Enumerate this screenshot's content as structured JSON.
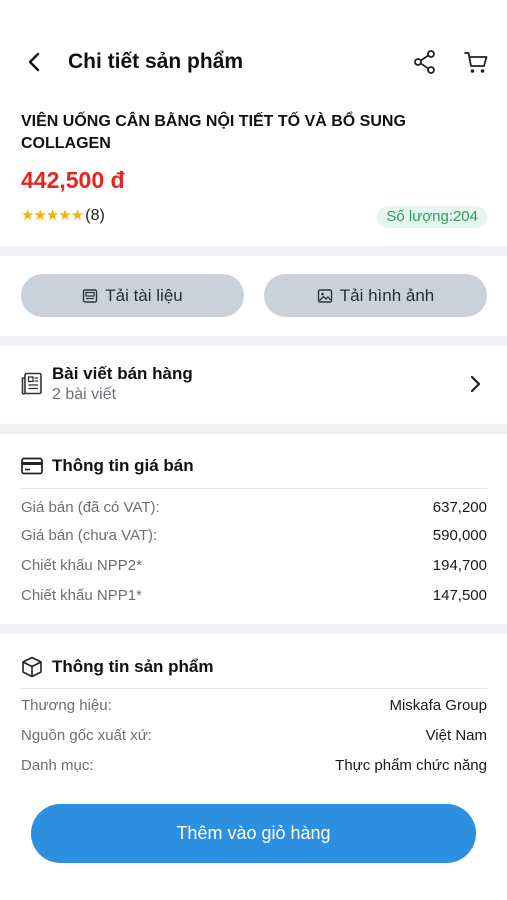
{
  "header": {
    "title": "Chi tiết sản phẩm"
  },
  "product": {
    "name": "VIÊN UỐNG CÂN BẰNG NỘI TIẾT TỐ VÀ BỔ SUNG COLLAGEN",
    "price": "442,500 đ",
    "stars": "★★★★★",
    "rating_count": "(8)",
    "quantity": "Số lượng:204"
  },
  "actions": {
    "download_docs": "Tải tài liệu",
    "download_images": "Tải hình ảnh"
  },
  "posts": {
    "title": "Bài viết bán hàng",
    "subtitle": "2 bài viết"
  },
  "price_info": {
    "title": "Thông tin giá bán",
    "rows": [
      {
        "label": "Giá bán (đã có VAT):",
        "value": "637,200"
      },
      {
        "label": "Giá bán (chưa VAT):",
        "value": "590,000"
      },
      {
        "label": "Chiết khấu NPP2*",
        "value": "194,700"
      },
      {
        "label": "Chiết khấu NPP1*",
        "value": "147,500"
      }
    ]
  },
  "product_info": {
    "title": "Thông tin sản phẩm",
    "rows": [
      {
        "label": "Thương hiệu:",
        "value": "Miskafa Group"
      },
      {
        "label": "Nguồn gốc xuất xứ:",
        "value": "Việt Nam"
      },
      {
        "label": "Danh mục:",
        "value": "Thực phẩm chức năng"
      }
    ]
  },
  "cta": {
    "add_to_cart": "Thêm vào giỏ hàng"
  },
  "colors": {
    "price": "#e8231d",
    "accent": "#2d8fe0",
    "quantity_badge": "#2e9e5b",
    "stars": "#f5b301"
  }
}
